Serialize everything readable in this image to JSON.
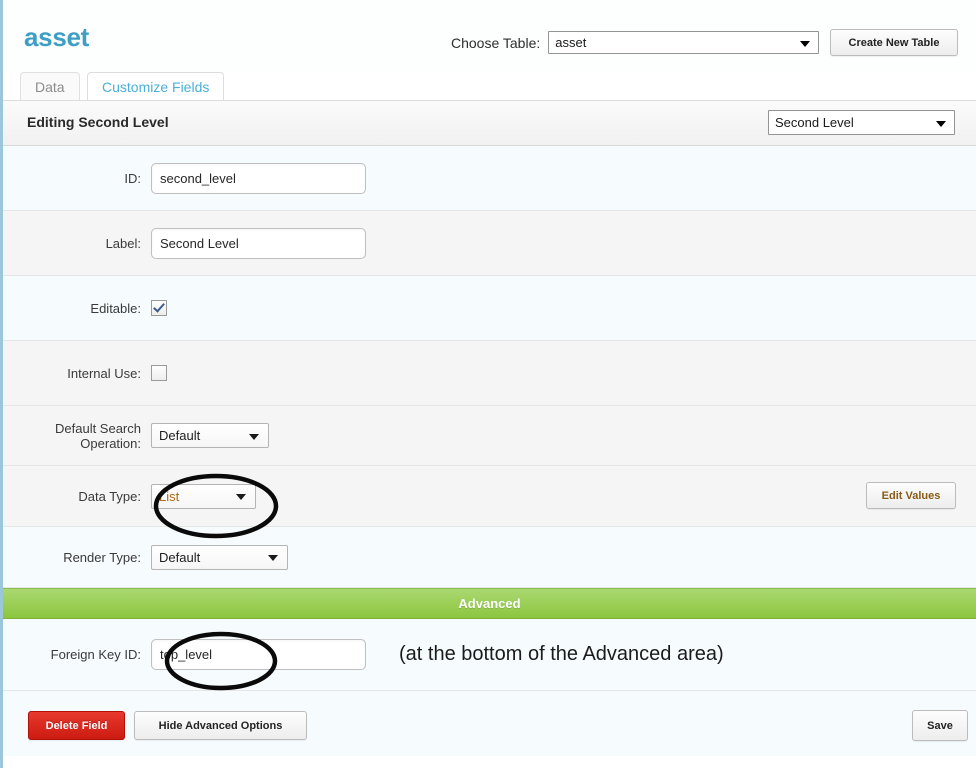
{
  "header": {
    "logo": "asset",
    "choose_table_label": "Choose Table:",
    "choose_table_value": "asset",
    "create_table_button": "Create New Table"
  },
  "tabs": [
    {
      "label": "Data",
      "active": false
    },
    {
      "label": "Customize Fields",
      "active": true
    }
  ],
  "editing": {
    "title": "Editing Second Level",
    "field_select_value": "Second Level"
  },
  "form": {
    "rows": [
      {
        "label": "ID:",
        "value": "second_level"
      },
      {
        "label": "Label:",
        "value": "Second Level"
      },
      {
        "label": "Editable:",
        "checked": true
      },
      {
        "label": "Internal Use:",
        "checked": false
      },
      {
        "label": "Default Search\nOperation:",
        "value": "Default"
      },
      {
        "label": "Data Type:",
        "value": "List"
      },
      {
        "label": "Render Type:",
        "value": "Default"
      }
    ],
    "label_id": "ID:",
    "label_label": "Label:",
    "label_editable": "Editable:",
    "label_internal_use": "Internal Use:",
    "label_search_op_line1": "Default Search",
    "label_search_op_line2": "Operation:",
    "label_data_type": "Data Type:",
    "label_render_type": "Render Type:",
    "label_foreign_key": "Foreign Key ID:",
    "value_id": "second_level",
    "value_label": "Second Level",
    "value_search_op": "Default",
    "value_data_type": "List",
    "value_render_type": "Default",
    "value_foreign_key": "top_level",
    "edit_values_button": "Edit Values"
  },
  "advanced": {
    "banner": "Advanced",
    "note": "(at the bottom of the Advanced area)"
  },
  "footer": {
    "delete_field_button": "Delete Field",
    "hide_advanced_button": "Hide Advanced Options",
    "save_button": "Save"
  },
  "colors": {
    "logo_blue": "#3d9fc4",
    "tab_active_blue": "#4ab0d8",
    "advanced_green": "#8cc63f",
    "delete_red": "#cc1b11",
    "highlight_orange": "#b06a10",
    "left_border": "#9cc6d9",
    "row_light": "#f6fbfe",
    "row_shade": "#f5f5f5",
    "annotation_black": "#0a0a0a"
  },
  "annotations": [
    {
      "name": "data-type-circle",
      "target": "Data Type: List"
    },
    {
      "name": "foreign-key-circle",
      "target": "Foreign Key ID: top_level"
    }
  ]
}
